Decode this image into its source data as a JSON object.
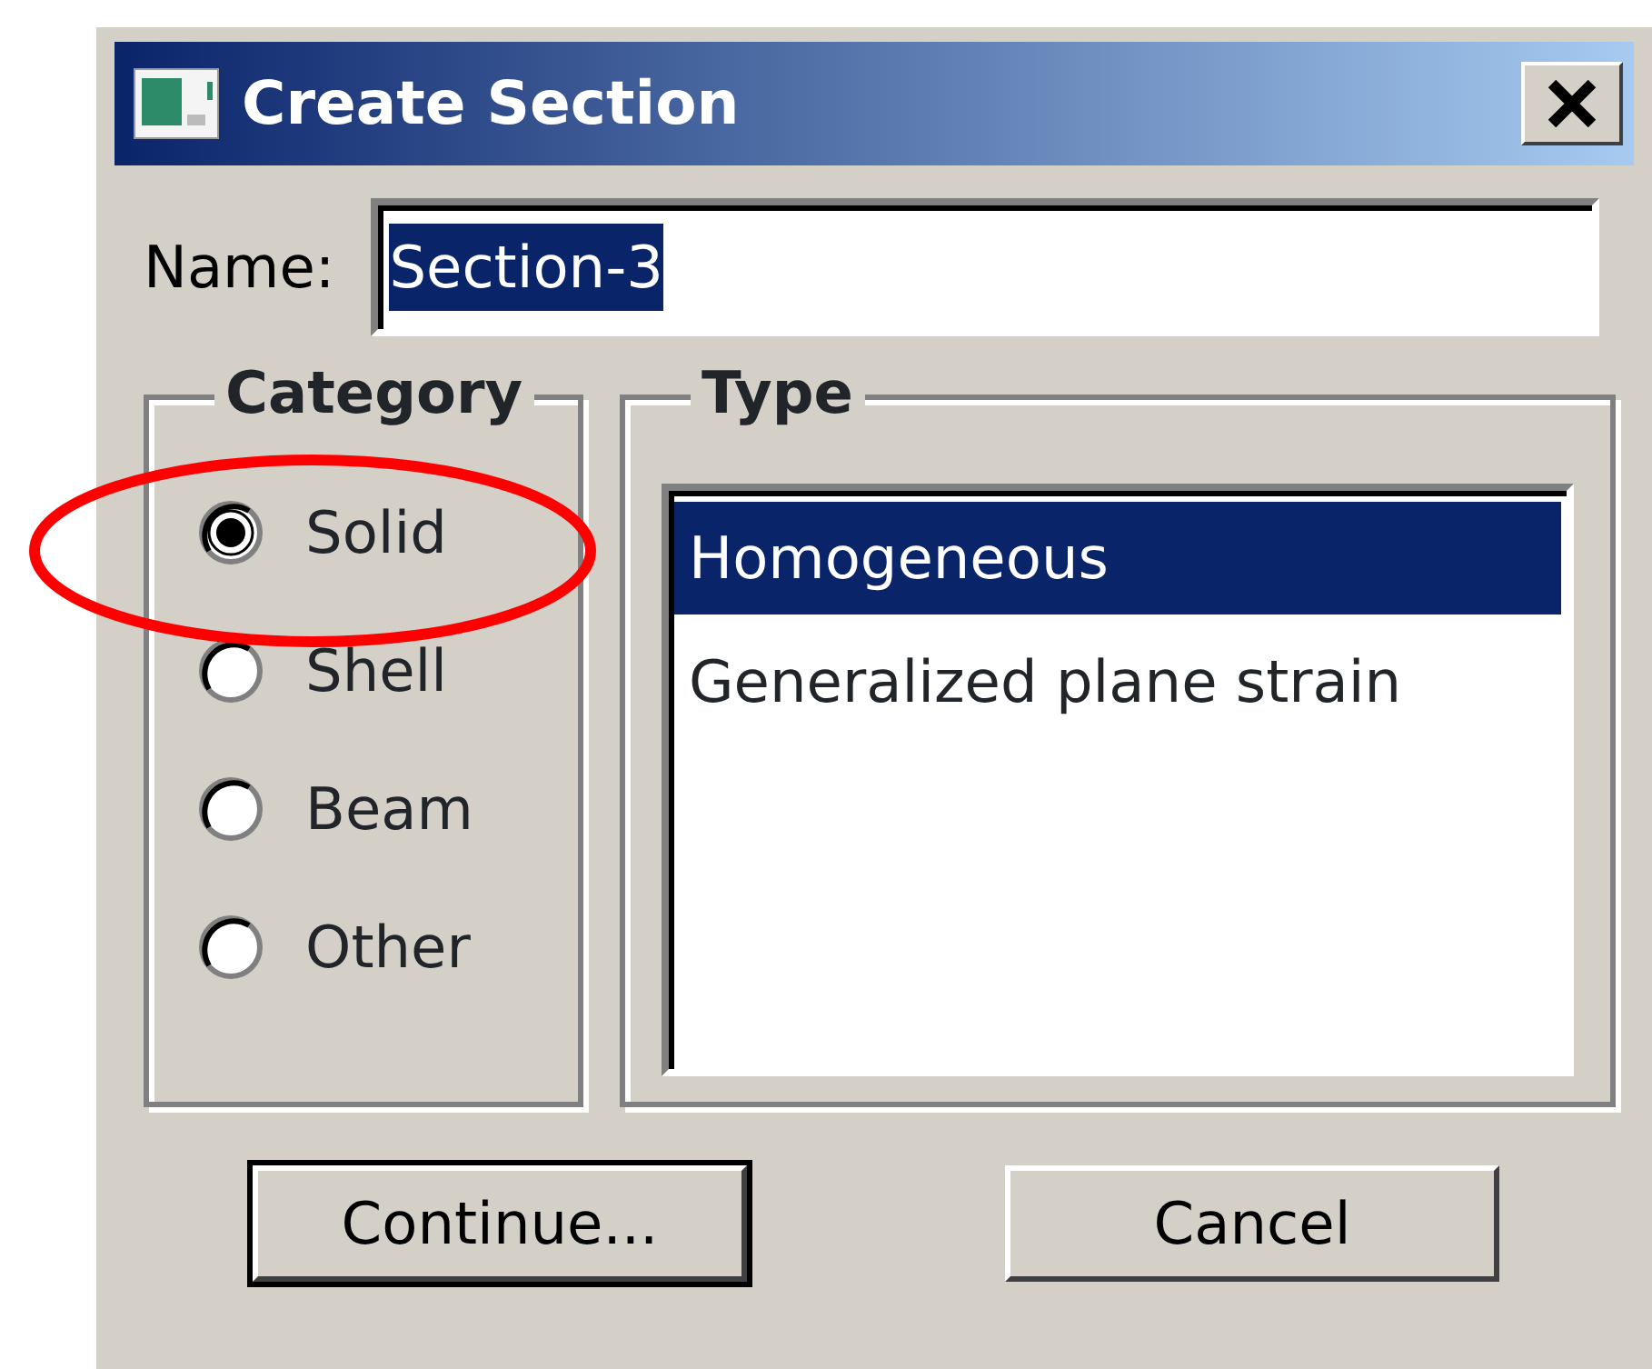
{
  "window": {
    "title": "Create Section"
  },
  "name_field": {
    "label": "Name:",
    "value": "Section-3",
    "text_selected": true
  },
  "category": {
    "legend": "Category",
    "options": [
      {
        "label": "Solid",
        "selected": true
      },
      {
        "label": "Shell",
        "selected": false
      },
      {
        "label": "Beam",
        "selected": false
      },
      {
        "label": "Other",
        "selected": false
      }
    ]
  },
  "type": {
    "legend": "Type",
    "items": [
      {
        "label": "Homogeneous",
        "selected": true
      },
      {
        "label": "Generalized plane strain",
        "selected": false
      }
    ]
  },
  "buttons": [
    "Continue...",
    "Cancel"
  ]
}
